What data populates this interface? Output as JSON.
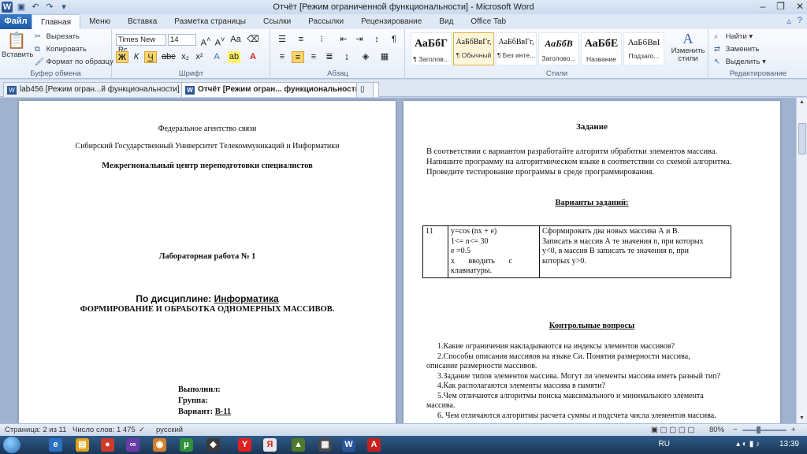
{
  "window": {
    "title": "Отчёт [Режим ограниченной функциональности] - Microsoft Word"
  },
  "ribbon_tabs": [
    "Файл",
    "Главная",
    "Меню",
    "Вставка",
    "Разметка страницы",
    "Ссылки",
    "Рассылки",
    "Рецензирование",
    "Вид",
    "Office Tab"
  ],
  "clipboard": {
    "paste": "Вставить",
    "cut": "Вырезать",
    "copy": "Копировать",
    "format_painter": "Формат по образцу",
    "label": "Буфер обмена"
  },
  "font": {
    "name": "Times New Rc",
    "size": "14",
    "label": "Шрифт",
    "bold": "Ж",
    "italic": "К",
    "underline": "Ч"
  },
  "paragraph": {
    "label": "Абзац"
  },
  "styles": {
    "label": "Стили",
    "items": [
      {
        "preview": "АаБбГ",
        "name": "¶ Заголов..."
      },
      {
        "preview": "АаБбВвГг,",
        "name": "¶ Обычный"
      },
      {
        "preview": "АаБбВвГг,",
        "name": "¶ Без инте..."
      },
      {
        "preview": "АаБбВ",
        "name": "Заголово..."
      },
      {
        "preview": "АаБбЕ",
        "name": "Название"
      },
      {
        "preview": "АаБбВвІ",
        "name": "Подзаго..."
      }
    ],
    "change": "Изменить стили"
  },
  "editing": {
    "label": "Редактирование",
    "find": "Найти",
    "replace": "Заменить",
    "select": "Выделить"
  },
  "doc_tabs": [
    {
      "label": "lab456 [Режим огран...й функциональности]"
    },
    {
      "label": "Отчёт [Режим огран... функциональности]"
    }
  ],
  "page1": {
    "agency": "Федеральное агентство связи",
    "university": "Сибирский Государственный Университет Телекоммуникаций и Информатики",
    "center": "Межрегиональный центр переподготовки специалистов",
    "lab": "Лабораторная работа № 1",
    "discipline_label": "По дисциплине:",
    "discipline": "Информатика",
    "topic": "ФОРМИРОВАНИЕ И ОБРАБОТКА ОДНОМЕРНЫХ МАССИВОВ.",
    "done_by": "Выполнил:",
    "group": "Группа:",
    "variant_label": "Вариант:",
    "variant": "В-11"
  },
  "page2": {
    "task_heading": "Задание",
    "task_text_1": "В соответствии с вариантом разработайте алгоритм обработки элементов массива.",
    "task_text_2": "Напишите программу на алгоритмическом языке в соответствии со схемой алгоритма.",
    "task_text_3": "Проведите тестирование программы в среде программирования.",
    "variants_heading": "Варианты заданий:",
    "table": {
      "num": "11",
      "formula_1": "y=cos (nx + e)",
      "formula_2": "1<= n<= 30",
      "formula_3": "e =0.5",
      "formula_4": "x       вводить       с",
      "formula_5": "клавиатуры.",
      "desc_1": "Сформировать два новых массива  А  и  В.",
      "desc_2": "Записать в массив А те значения n, при которых",
      "desc_3": "y<0,  в  массив  В  записать  те  значения  n,  при",
      "desc_4": "которых y>0."
    },
    "questions_heading": "Контрольные вопросы",
    "questions": [
      "1.Какие ограничения накладываются на индексы элементов массивов?",
      "2.Способы описания массивов на языке Си. Понятия размерности массива,",
      "описание размерности массивов.",
      "3.Задание типов элементов массива. Могут ли элементы массива иметь разный тип?",
      "4.Как располагаются элементы  массива в памяти?",
      "5.Чем отличаются алгоритмы поиска максимального и минимального элемента",
      "массива.",
      "6.  Чем отличаются алгоритмы расчета суммы и подсчета числа элементов массива."
    ]
  },
  "status": {
    "page": "Страница: 2 из 11",
    "words": "Число слов: 1 475",
    "language": "русский",
    "zoom": "80%"
  },
  "taskbar": {
    "lang": "RU",
    "time": "13:39"
  }
}
